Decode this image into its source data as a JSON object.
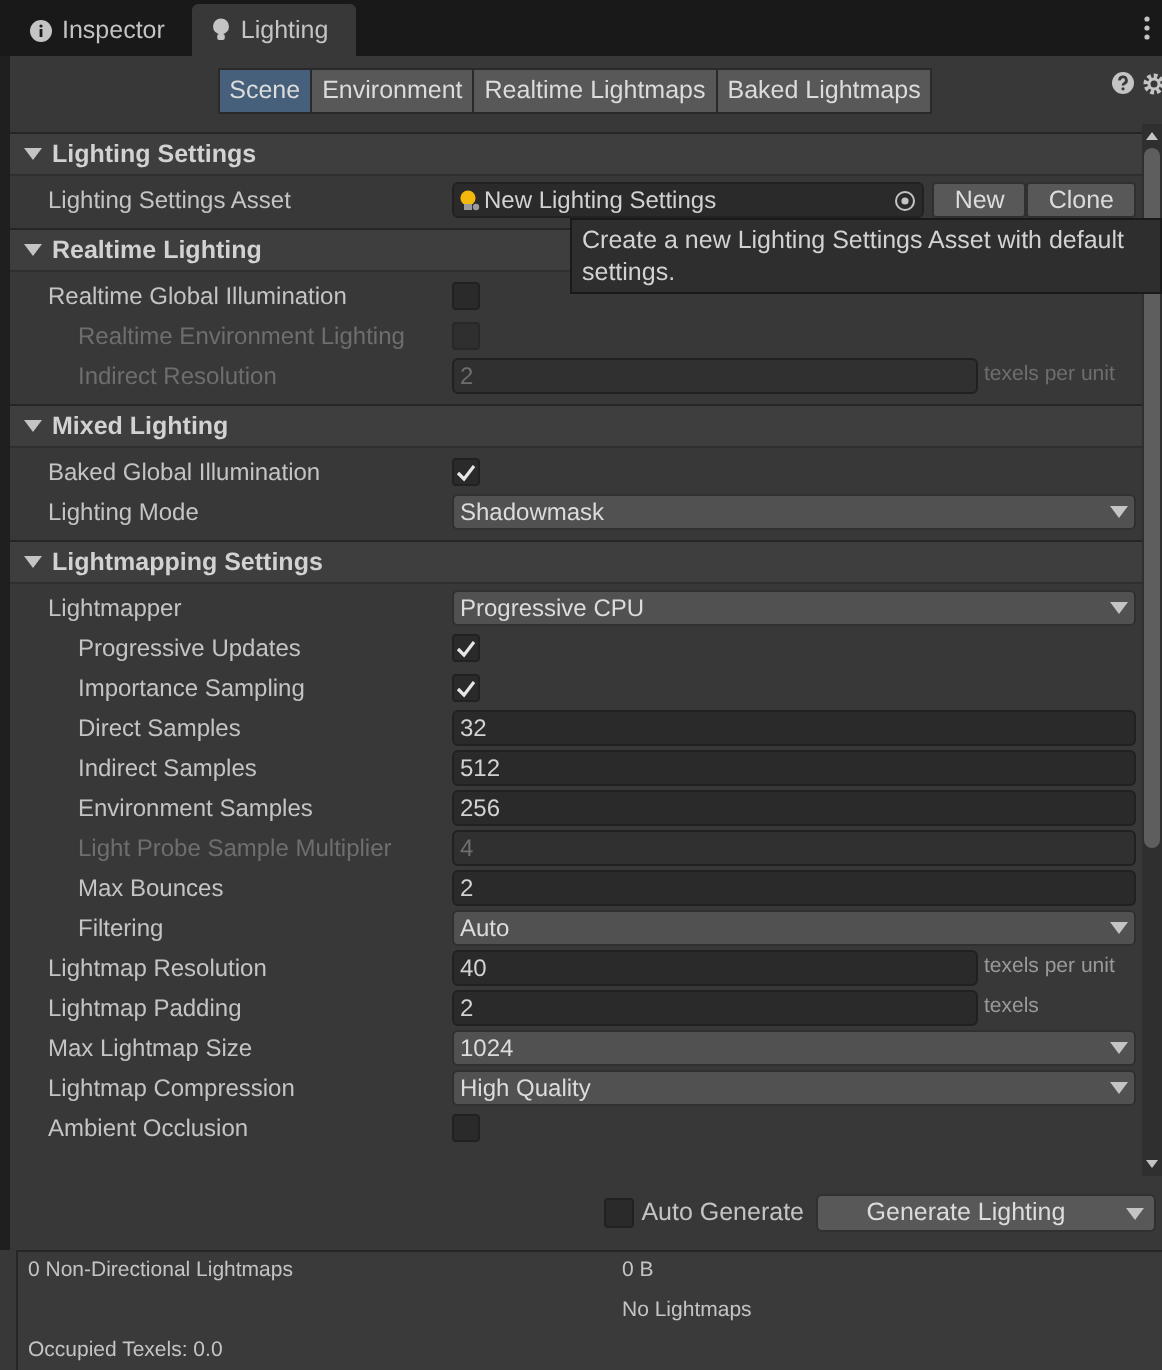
{
  "tabs": [
    {
      "label": "Inspector",
      "kind": "info",
      "selected": false
    },
    {
      "label": "Lighting",
      "kind": "bulb",
      "selected": true
    }
  ],
  "subtabs": [
    {
      "label": "Scene",
      "selected": true
    },
    {
      "label": "Environment",
      "selected": false
    },
    {
      "label": "Realtime Lightmaps",
      "selected": false
    },
    {
      "label": "Baked Lightmaps",
      "selected": false
    }
  ],
  "sections": [
    {
      "title": "Lighting Settings",
      "expanded": true,
      "rows": [
        {
          "kind": "object",
          "label": "Lighting Settings Asset",
          "value": "New Lighting Settings",
          "buttons": [
            "New",
            "Clone"
          ]
        }
      ]
    },
    {
      "title": "Realtime Lighting",
      "expanded": true,
      "rows": [
        {
          "kind": "checkbox",
          "label": "Realtime Global Illumination",
          "checked": false,
          "disabled": false,
          "children": [
            {
              "kind": "checkbox",
              "label": "Realtime Environment Lighting",
              "checked": false,
              "disabled": true
            },
            {
              "kind": "number",
              "label": "Indirect Resolution",
              "value": "2",
              "suffix": "texels per unit",
              "disabled": true
            }
          ]
        }
      ]
    },
    {
      "title": "Mixed Lighting",
      "expanded": true,
      "rows": [
        {
          "kind": "checkbox",
          "label": "Baked Global Illumination",
          "checked": true,
          "disabled": false
        },
        {
          "kind": "dropdown",
          "label": "Lighting Mode",
          "value": "Shadowmask"
        }
      ]
    },
    {
      "title": "Lightmapping Settings",
      "expanded": true,
      "rows": [
        {
          "kind": "dropdown",
          "label": "Lightmapper",
          "value": "Progressive CPU",
          "children": [
            {
              "kind": "checkbox",
              "label": "Progressive Updates",
              "checked": true,
              "disabled": false
            },
            {
              "kind": "checkbox",
              "label": "Importance Sampling",
              "checked": true,
              "disabled": false
            },
            {
              "kind": "number",
              "label": "Direct Samples",
              "value": "32",
              "disabled": false
            },
            {
              "kind": "number",
              "label": "Indirect Samples",
              "value": "512",
              "disabled": false
            },
            {
              "kind": "number",
              "label": "Environment Samples",
              "value": "256",
              "disabled": false
            },
            {
              "kind": "number",
              "label": "Light Probe Sample Multiplier",
              "value": "4",
              "disabled": true
            },
            {
              "kind": "number",
              "label": "Max Bounces",
              "value": "2",
              "disabled": false
            },
            {
              "kind": "dropdown",
              "label": "Filtering",
              "value": "Auto"
            }
          ]
        },
        {
          "kind": "number",
          "label": "Lightmap Resolution",
          "value": "40",
          "suffix": "texels per unit",
          "disabled": false
        },
        {
          "kind": "number",
          "label": "Lightmap Padding",
          "value": "2",
          "suffix": "texels",
          "disabled": false
        },
        {
          "kind": "dropdown",
          "label": "Max Lightmap Size",
          "value": "1024"
        },
        {
          "kind": "dropdown",
          "label": "Lightmap Compression",
          "value": "High Quality"
        },
        {
          "kind": "checkbox",
          "label": "Ambient Occlusion",
          "checked": false,
          "disabled": false
        }
      ]
    }
  ],
  "tooltip": "Create a new Lighting Settings Asset with default settings.",
  "auto_generate": {
    "label": "Auto Generate",
    "checked": false
  },
  "generate_button": "Generate Lighting",
  "stats": {
    "lightmaps": "0 Non-Directional Lightmaps",
    "size": "0 B",
    "status": "No Lightmaps",
    "occupied": "Occupied Texels: 0.0"
  }
}
